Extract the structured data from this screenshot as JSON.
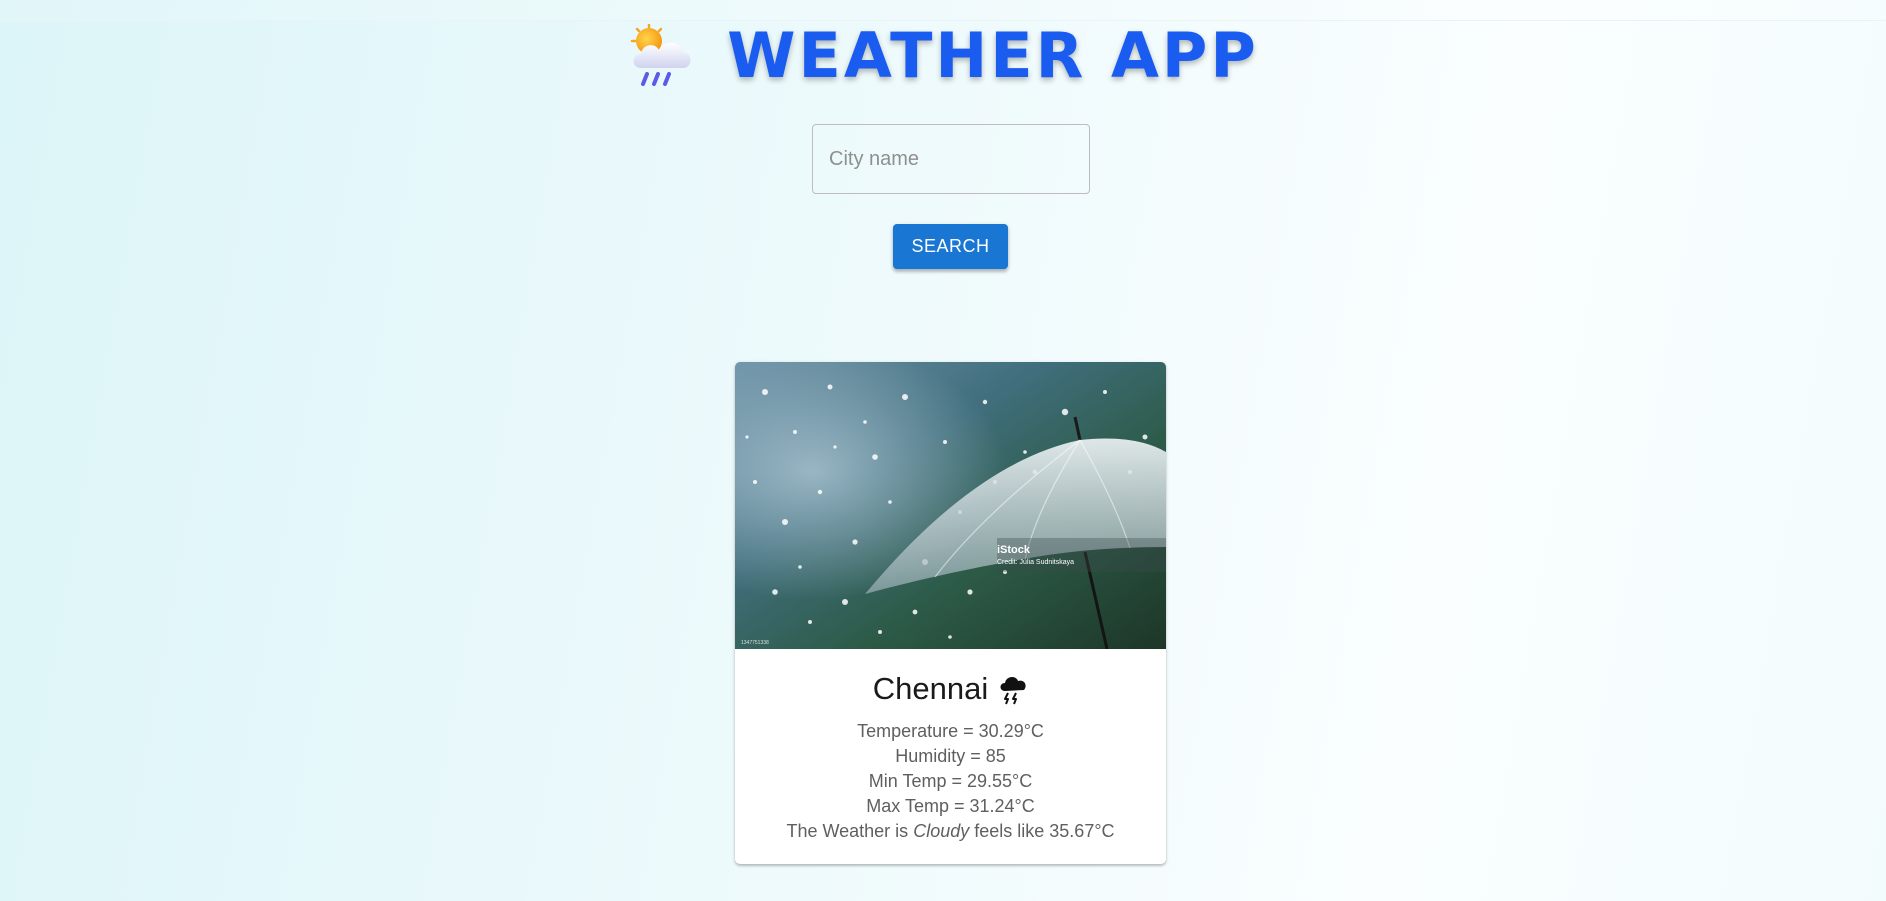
{
  "header": {
    "title": "WEATHER APP",
    "icon": "sun-cloud-rain-icon"
  },
  "search": {
    "placeholder": "City name",
    "value": "",
    "button_label": "SEARCH"
  },
  "card": {
    "image": {
      "icon": "umbrella-rain-photo",
      "watermark_brand": "iStock",
      "watermark_credit": "Credit: Julia  Sudnitskaya",
      "corner_code": "1347751338"
    },
    "city": "Chennai",
    "weather_icon": "thunder-cloud-icon",
    "temperature_line": "Temperature = 30.29°C",
    "humidity_line": "Humidity = 85",
    "min_temp_line": "Min Temp = 29.55°C",
    "max_temp_line": "Max Temp = 31.24°C",
    "summary_prefix": "The Weather is",
    "condition": "Cloudy",
    "feels_like_line": "feels like 35.67°C"
  },
  "colors": {
    "title": "#1a5bf0",
    "button": "#1976d2",
    "background": "#e6f8fa"
  }
}
